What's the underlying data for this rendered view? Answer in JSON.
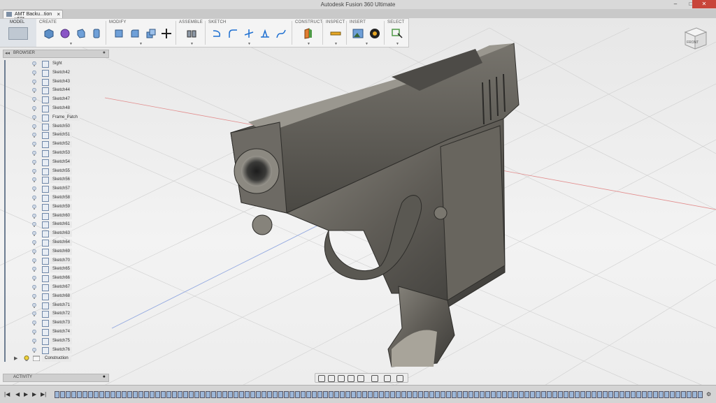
{
  "window": {
    "title": "Autodesk Fusion 360 Ultimate",
    "minimize": "–",
    "maximize": "□",
    "close": "✕"
  },
  "tab": {
    "label": "AMT Backu...tion v68*",
    "close": "×"
  },
  "toolbar": {
    "workspace": {
      "label": "MODEL",
      "icon": "model-workspace-icon"
    },
    "groups": [
      {
        "label": "CREATE",
        "tools": [
          "box-icon",
          "sphere-icon",
          "extrude-icon",
          "revolve-icon"
        ]
      },
      {
        "label": "MODIFY",
        "tools": [
          "press-pull-icon",
          "fillet-icon",
          "combine-icon",
          "move-icon"
        ]
      },
      {
        "label": "ASSEMBLE",
        "tools": [
          "joint-icon"
        ]
      },
      {
        "label": "SKETCH",
        "tools": [
          "arc-icon",
          "fillet-sketch-icon",
          "trim-icon",
          "project-icon",
          "spline-icon"
        ]
      },
      {
        "label": "CONSTRUCT",
        "tools": [
          "plane-icon"
        ]
      },
      {
        "label": "INSPECT",
        "tools": [
          "measure-icon"
        ]
      },
      {
        "label": "INSERT",
        "tools": [
          "insert-image-icon",
          "decal-icon"
        ]
      },
      {
        "label": "SELECT",
        "tools": [
          "select-icon"
        ]
      }
    ]
  },
  "viewcube": {
    "face": "FRONT"
  },
  "browser": {
    "title": "BROWSER",
    "items": [
      "Sight",
      "Sketch42",
      "Sketch43",
      "Sketch44",
      "Sketch47",
      "Sketch48",
      "Frame_Patch",
      "Sketch50",
      "Sketch51",
      "Sketch52",
      "Sketch53",
      "Sketch54",
      "Sketch55",
      "Sketch56",
      "Sketch57",
      "Sketch58",
      "Sketch59",
      "Sketch60",
      "Sketch61",
      "Sketch63",
      "Sketch64",
      "Sketch69",
      "Sketch70",
      "Sketch65",
      "Sketch66",
      "Sketch67",
      "Sketch68",
      "Sketch71",
      "Sketch72",
      "Sketch73",
      "Sketch74",
      "Sketch75",
      "Sketch76"
    ],
    "folder": "Construction"
  },
  "activity": {
    "title": "ACTIVITY"
  },
  "colors": {
    "accent": "#1d6fd1",
    "model": "#5c5a55",
    "close": "#c8453a"
  }
}
